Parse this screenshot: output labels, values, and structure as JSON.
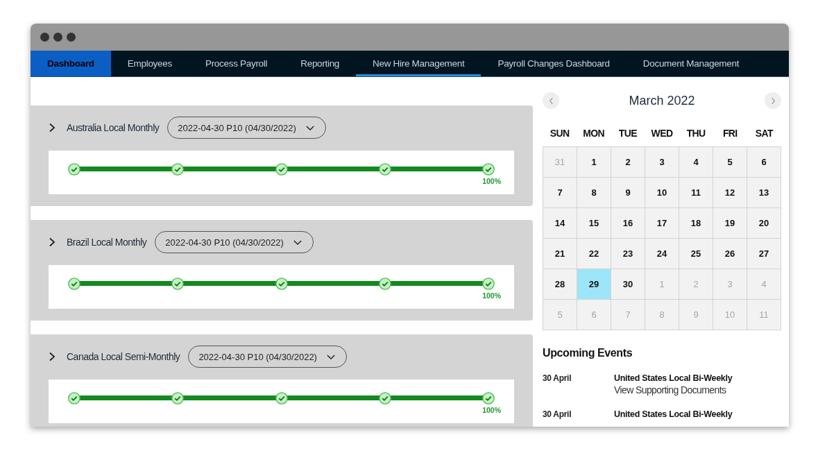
{
  "nav": {
    "tabs": [
      {
        "label": "Dashboard",
        "selected": true,
        "hovered": false
      },
      {
        "label": "Employees",
        "selected": false,
        "hovered": false
      },
      {
        "label": "Process Payroll",
        "selected": false,
        "hovered": false
      },
      {
        "label": "Reporting",
        "selected": false,
        "hovered": false
      },
      {
        "label": "New Hire Management",
        "selected": false,
        "hovered": true
      },
      {
        "label": "Payroll Changes Dashboard",
        "selected": false,
        "hovered": false
      },
      {
        "label": "Document Management",
        "selected": false,
        "hovered": false
      }
    ]
  },
  "payrolls": [
    {
      "name": "Australia Local Monthly",
      "expanded": false,
      "period": "2022-04-30 P10 (04/30/2022)",
      "progress": {
        "level": 1,
        "reading": "100%",
        "steps": [
          {
            "done": true
          },
          {
            "done": true
          },
          {
            "done": true
          },
          {
            "done": true
          },
          {
            "done": true
          }
        ]
      }
    },
    {
      "name": "Brazil Local Monthly",
      "expanded": false,
      "period": "2022-04-30 P10 (04/30/2022)",
      "progress": {
        "level": 1,
        "reading": "100%",
        "steps": [
          {
            "done": true
          },
          {
            "done": true
          },
          {
            "done": true
          },
          {
            "done": true
          },
          {
            "done": true
          }
        ]
      }
    },
    {
      "name": "Canada Local Semi-Monthly",
      "expanded": false,
      "period": "2022-04-30 P10 (04/30/2022)",
      "progress": {
        "level": 1,
        "reading": "100%",
        "steps": [
          {
            "done": true
          },
          {
            "done": true
          },
          {
            "done": true
          },
          {
            "done": true
          },
          {
            "done": true
          }
        ]
      }
    }
  ],
  "calendar": {
    "title": "March 2022",
    "weekdays": [
      "SUN",
      "MON",
      "TUE",
      "WED",
      "THU",
      "FRI",
      "SAT"
    ],
    "weeks": [
      [
        {
          "day": "31",
          "in_month": false,
          "selected": false
        },
        {
          "day": "1",
          "in_month": true,
          "selected": false
        },
        {
          "day": "2",
          "in_month": true,
          "selected": false
        },
        {
          "day": "3",
          "in_month": true,
          "selected": false
        },
        {
          "day": "4",
          "in_month": true,
          "selected": false
        },
        {
          "day": "5",
          "in_month": true,
          "selected": false
        },
        {
          "day": "6",
          "in_month": true,
          "selected": false
        }
      ],
      [
        {
          "day": "7",
          "in_month": true,
          "selected": false
        },
        {
          "day": "8",
          "in_month": true,
          "selected": false
        },
        {
          "day": "9",
          "in_month": true,
          "selected": false
        },
        {
          "day": "10",
          "in_month": true,
          "selected": false
        },
        {
          "day": "11",
          "in_month": true,
          "selected": false
        },
        {
          "day": "12",
          "in_month": true,
          "selected": false
        },
        {
          "day": "13",
          "in_month": true,
          "selected": false
        }
      ],
      [
        {
          "day": "14",
          "in_month": true,
          "selected": false
        },
        {
          "day": "15",
          "in_month": true,
          "selected": false
        },
        {
          "day": "16",
          "in_month": true,
          "selected": false
        },
        {
          "day": "17",
          "in_month": true,
          "selected": false
        },
        {
          "day": "18",
          "in_month": true,
          "selected": false
        },
        {
          "day": "19",
          "in_month": true,
          "selected": false
        },
        {
          "day": "20",
          "in_month": true,
          "selected": false
        }
      ],
      [
        {
          "day": "21",
          "in_month": true,
          "selected": false
        },
        {
          "day": "22",
          "in_month": true,
          "selected": false
        },
        {
          "day": "23",
          "in_month": true,
          "selected": false
        },
        {
          "day": "24",
          "in_month": true,
          "selected": false
        },
        {
          "day": "25",
          "in_month": true,
          "selected": false
        },
        {
          "day": "26",
          "in_month": true,
          "selected": false
        },
        {
          "day": "27",
          "in_month": true,
          "selected": false
        }
      ],
      [
        {
          "day": "28",
          "in_month": true,
          "selected": false
        },
        {
          "day": "29",
          "in_month": true,
          "selected": true
        },
        {
          "day": "30",
          "in_month": true,
          "selected": false
        },
        {
          "day": "1",
          "in_month": false,
          "selected": false
        },
        {
          "day": "2",
          "in_month": false,
          "selected": false
        },
        {
          "day": "3",
          "in_month": false,
          "selected": false
        },
        {
          "day": "4",
          "in_month": false,
          "selected": false
        }
      ],
      [
        {
          "day": "5",
          "in_month": false,
          "selected": false
        },
        {
          "day": "6",
          "in_month": false,
          "selected": false
        },
        {
          "day": "7",
          "in_month": false,
          "selected": false
        },
        {
          "day": "8",
          "in_month": false,
          "selected": false
        },
        {
          "day": "9",
          "in_month": false,
          "selected": false
        },
        {
          "day": "10",
          "in_month": false,
          "selected": false
        },
        {
          "day": "11",
          "in_month": false,
          "selected": false
        }
      ]
    ]
  },
  "upcoming_events": {
    "title": "Upcoming Events",
    "events": [
      {
        "date": "30 April",
        "title": "United States Local Bi-Weekly",
        "link": "View Supporting Documents"
      },
      {
        "date": "30 April",
        "title": "United States Local Bi-Weekly"
      }
    ]
  }
}
